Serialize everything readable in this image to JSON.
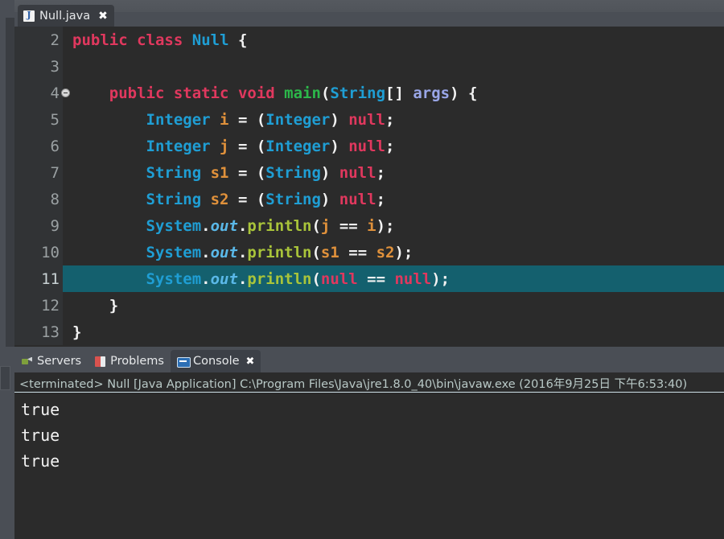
{
  "window": {
    "accent_highlight": "#14606e",
    "editor_bg": "#2b2b2b",
    "chrome_bg": "#4a4e55"
  },
  "editor_tab": {
    "filename": "Null.java",
    "icon": "java-file-icon",
    "close_glyph": "✖"
  },
  "code": {
    "language": "java",
    "first_visible_line": 2,
    "highlighted_line": 11,
    "lines": [
      {
        "number": "2",
        "fold": false,
        "highlighted": false,
        "tokens": [
          {
            "t": "public",
            "c": "kw"
          },
          {
            "t": " ",
            "c": "pln"
          },
          {
            "t": "class",
            "c": "kw"
          },
          {
            "t": " ",
            "c": "pln"
          },
          {
            "t": "Null",
            "c": "type"
          },
          {
            "t": " {",
            "c": "pln"
          }
        ]
      },
      {
        "number": "3",
        "fold": false,
        "highlighted": false,
        "tokens": []
      },
      {
        "number": "4",
        "fold": true,
        "highlighted": false,
        "tokens": [
          {
            "t": "    ",
            "c": "pln"
          },
          {
            "t": "public",
            "c": "kw"
          },
          {
            "t": " ",
            "c": "pln"
          },
          {
            "t": "static",
            "c": "kw"
          },
          {
            "t": " ",
            "c": "pln"
          },
          {
            "t": "void",
            "c": "kw"
          },
          {
            "t": " ",
            "c": "pln"
          },
          {
            "t": "main",
            "c": "mgrn"
          },
          {
            "t": "(",
            "c": "pln"
          },
          {
            "t": "String",
            "c": "type"
          },
          {
            "t": "[] ",
            "c": "pln"
          },
          {
            "t": "args",
            "c": "stat"
          },
          {
            "t": ") {",
            "c": "pln"
          }
        ]
      },
      {
        "number": "5",
        "fold": false,
        "highlighted": false,
        "tokens": [
          {
            "t": "        ",
            "c": "pln"
          },
          {
            "t": "Integer",
            "c": "type"
          },
          {
            "t": " ",
            "c": "pln"
          },
          {
            "t": "i",
            "c": "var"
          },
          {
            "t": " = (",
            "c": "pln"
          },
          {
            "t": "Integer",
            "c": "type"
          },
          {
            "t": ") ",
            "c": "pln"
          },
          {
            "t": "null",
            "c": "nul"
          },
          {
            "t": ";",
            "c": "pln"
          }
        ]
      },
      {
        "number": "6",
        "fold": false,
        "highlighted": false,
        "tokens": [
          {
            "t": "        ",
            "c": "pln"
          },
          {
            "t": "Integer",
            "c": "type"
          },
          {
            "t": " ",
            "c": "pln"
          },
          {
            "t": "j",
            "c": "var"
          },
          {
            "t": " = (",
            "c": "pln"
          },
          {
            "t": "Integer",
            "c": "type"
          },
          {
            "t": ") ",
            "c": "pln"
          },
          {
            "t": "null",
            "c": "nul"
          },
          {
            "t": ";",
            "c": "pln"
          }
        ]
      },
      {
        "number": "7",
        "fold": false,
        "highlighted": false,
        "tokens": [
          {
            "t": "        ",
            "c": "pln"
          },
          {
            "t": "String",
            "c": "type"
          },
          {
            "t": " ",
            "c": "pln"
          },
          {
            "t": "s1",
            "c": "var"
          },
          {
            "t": " = (",
            "c": "pln"
          },
          {
            "t": "String",
            "c": "type"
          },
          {
            "t": ") ",
            "c": "pln"
          },
          {
            "t": "null",
            "c": "nul"
          },
          {
            "t": ";",
            "c": "pln"
          }
        ]
      },
      {
        "number": "8",
        "fold": false,
        "highlighted": false,
        "tokens": [
          {
            "t": "        ",
            "c": "pln"
          },
          {
            "t": "String",
            "c": "type"
          },
          {
            "t": " ",
            "c": "pln"
          },
          {
            "t": "s2",
            "c": "var"
          },
          {
            "t": " = (",
            "c": "pln"
          },
          {
            "t": "String",
            "c": "type"
          },
          {
            "t": ") ",
            "c": "pln"
          },
          {
            "t": "null",
            "c": "nul"
          },
          {
            "t": ";",
            "c": "pln"
          }
        ]
      },
      {
        "number": "9",
        "fold": false,
        "highlighted": false,
        "tokens": [
          {
            "t": "        ",
            "c": "pln"
          },
          {
            "t": "System",
            "c": "type"
          },
          {
            "t": ".",
            "c": "pln"
          },
          {
            "t": "out",
            "c": "ital"
          },
          {
            "t": ".",
            "c": "pln"
          },
          {
            "t": "println",
            "c": "meth"
          },
          {
            "t": "(",
            "c": "pln"
          },
          {
            "t": "j",
            "c": "var"
          },
          {
            "t": " == ",
            "c": "pln"
          },
          {
            "t": "i",
            "c": "var"
          },
          {
            "t": ");",
            "c": "pln"
          }
        ]
      },
      {
        "number": "10",
        "fold": false,
        "highlighted": false,
        "tokens": [
          {
            "t": "        ",
            "c": "pln"
          },
          {
            "t": "System",
            "c": "type"
          },
          {
            "t": ".",
            "c": "pln"
          },
          {
            "t": "out",
            "c": "ital"
          },
          {
            "t": ".",
            "c": "pln"
          },
          {
            "t": "println",
            "c": "meth"
          },
          {
            "t": "(",
            "c": "pln"
          },
          {
            "t": "s1",
            "c": "var"
          },
          {
            "t": " == ",
            "c": "pln"
          },
          {
            "t": "s2",
            "c": "var"
          },
          {
            "t": ");",
            "c": "pln"
          }
        ]
      },
      {
        "number": "11",
        "fold": false,
        "highlighted": true,
        "tokens": [
          {
            "t": "        ",
            "c": "pln"
          },
          {
            "t": "System",
            "c": "type"
          },
          {
            "t": ".",
            "c": "pln"
          },
          {
            "t": "out",
            "c": "ital"
          },
          {
            "t": ".",
            "c": "pln"
          },
          {
            "t": "println",
            "c": "meth"
          },
          {
            "t": "(",
            "c": "pln"
          },
          {
            "t": "null",
            "c": "nul"
          },
          {
            "t": " == ",
            "c": "pln"
          },
          {
            "t": "null",
            "c": "nul"
          },
          {
            "t": ");",
            "c": "pln"
          }
        ]
      },
      {
        "number": "12",
        "fold": false,
        "highlighted": false,
        "tokens": [
          {
            "t": "    }",
            "c": "pln"
          }
        ]
      },
      {
        "number": "13",
        "fold": false,
        "highlighted": false,
        "tokens": [
          {
            "t": "}",
            "c": "pln"
          }
        ]
      }
    ]
  },
  "bottom_panel": {
    "tabs": [
      {
        "label": "Servers",
        "icon": "servers-icon",
        "active": false,
        "closable": false
      },
      {
        "label": "Problems",
        "icon": "problems-icon",
        "active": false,
        "closable": false
      },
      {
        "label": "Console",
        "icon": "console-icon",
        "active": true,
        "closable": true
      }
    ],
    "close_glyph": "✖"
  },
  "console": {
    "status_line": "<terminated> Null [Java Application] C:\\Program Files\\Java\\jre1.8.0_40\\bin\\javaw.exe (2016年9月25日 下午6:53:40)",
    "output": [
      "true",
      "true",
      "true"
    ]
  }
}
